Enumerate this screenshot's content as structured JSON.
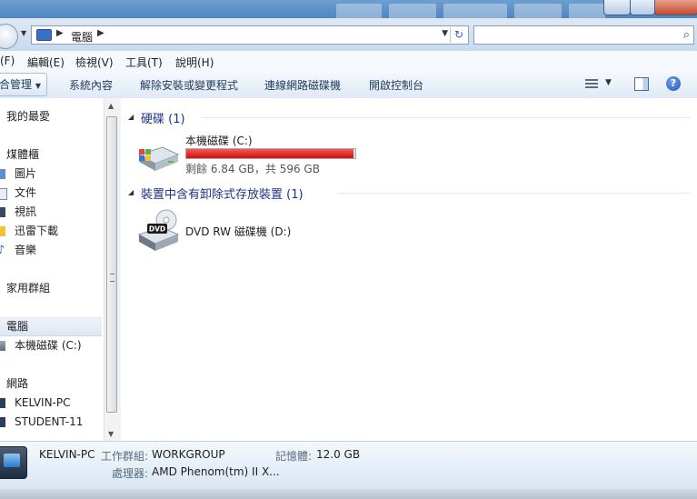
{
  "address": {
    "crumb": "電腦"
  },
  "search": {
    "placeholder": ""
  },
  "menu": {
    "items": [
      "(F)",
      "編輯(E)",
      "檢視(V)",
      "工具(T)",
      "說明(H)"
    ]
  },
  "toolbar": {
    "items": [
      "合管理",
      "系統內容",
      "解除安裝或變更程式",
      "連線網路磁碟機",
      "開啟控制台"
    ]
  },
  "nav": {
    "items": [
      {
        "label": "我的最愛"
      },
      {
        "label": "煤體櫃"
      },
      {
        "label": "圖片"
      },
      {
        "label": "文件"
      },
      {
        "label": "視訊"
      },
      {
        "label": "迅雷下載"
      },
      {
        "label": "音樂"
      },
      {
        "label": "家用群組"
      },
      {
        "label": "電腦"
      },
      {
        "label": "本機磁碟 (C:)"
      },
      {
        "label": "網路"
      },
      {
        "label": "KELVIN-PC"
      },
      {
        "label": "STUDENT-11"
      }
    ]
  },
  "groups": {
    "hard_disks": {
      "title": "硬碟 (1)"
    },
    "removable": {
      "title": "裝置中含有卸除式存放裝置 (1)"
    }
  },
  "drives": {
    "c": {
      "name": "本機磁碟 (C:)",
      "free": "剩餘 6.84 GB，共 596 GB",
      "used_fraction": 0.9885
    },
    "d": {
      "name": "DVD RW 磁碟機 (D:)",
      "badge": "DVD"
    }
  },
  "details": {
    "name": "KELVIN-PC",
    "workgroup_key": "工作群組:",
    "workgroup_val": "WORKGROUP",
    "memory_key": "記憶體:",
    "memory_val": "12.0 GB",
    "cpu_key": "處理器:",
    "cpu_val": "AMD Phenom(tm) II X..."
  },
  "colors": {
    "bar_fill": "#d30d0d",
    "group_title": "#1e3287"
  }
}
